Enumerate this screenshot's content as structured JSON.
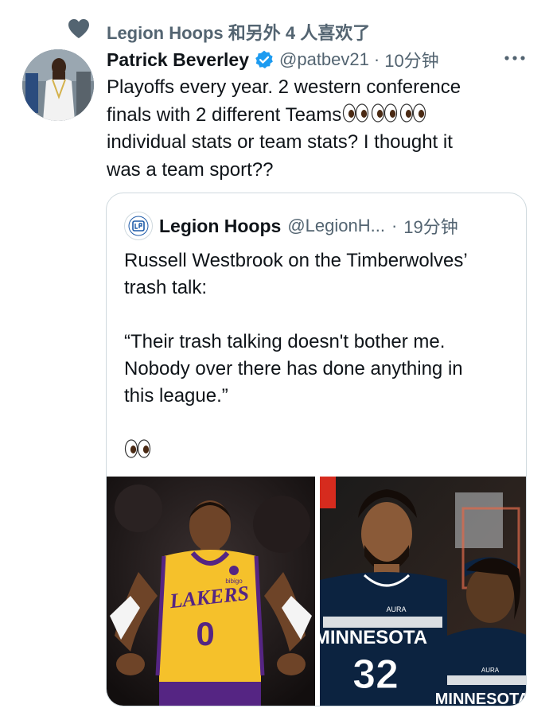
{
  "social_context": {
    "text": "Legion Hoops 和另外 4 人喜欢了",
    "icon": "heart-icon"
  },
  "tweet": {
    "author_name": "Patrick Beverley",
    "verified_icon": "verified-badge-icon",
    "handle": "@patbev21",
    "dot": "·",
    "time": "10分钟",
    "more_icon": "more-icon",
    "text_line1": "Playoffs every year. 2 western conference",
    "text_line2": "finals with 2 different Teams",
    "text_line3": "individual stats or team stats? I thought it",
    "text_line4": "was a team sport??"
  },
  "quote": {
    "author_name": "Legion Hoops",
    "handle": "@LegionH...",
    "dot": "·",
    "time": "19分钟",
    "text_para1_line1": "Russell Westbrook on the Timberwolves’",
    "text_para1_line2": "trash talk:",
    "text_para2_line1": "“Their trash talking doesn't bother me.",
    "text_para2_line2": "Nobody over there has done anything in",
    "text_para2_line3": "this league.”",
    "images": [
      {
        "jersey_team": "LAKERS",
        "jersey_number": "0",
        "patch": "bibigo"
      },
      {
        "jersey_team": "MINNESOTA",
        "jersey_number": "32",
        "second_jersey": "MINNESOTA",
        "brand": "AURA"
      }
    ]
  },
  "colors": {
    "text": "#0f1419",
    "secondary": "#536471",
    "verified": "#1d9bf0",
    "border": "#cfd9de",
    "lakers_gold": "#f5c12b",
    "lakers_purple": "#552583",
    "wolves_navy": "#0c2340"
  }
}
